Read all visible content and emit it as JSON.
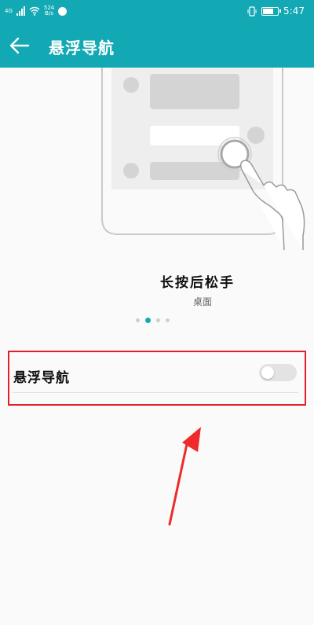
{
  "status_bar": {
    "network": "4G",
    "speed_value": "524",
    "speed_unit": "B/s",
    "time": "5:47",
    "battery_percent": 80
  },
  "app_bar": {
    "title": "悬浮导航"
  },
  "tutorial": {
    "caption": "长按后松手",
    "subcaption": "桌面",
    "page_count": 4,
    "active_page": 2
  },
  "setting": {
    "label": "悬浮导航",
    "enabled": false
  },
  "colors": {
    "accent": "#13a9b4",
    "highlight_box": "#e0202a",
    "annotation_arrow": "#ee2a2a"
  }
}
